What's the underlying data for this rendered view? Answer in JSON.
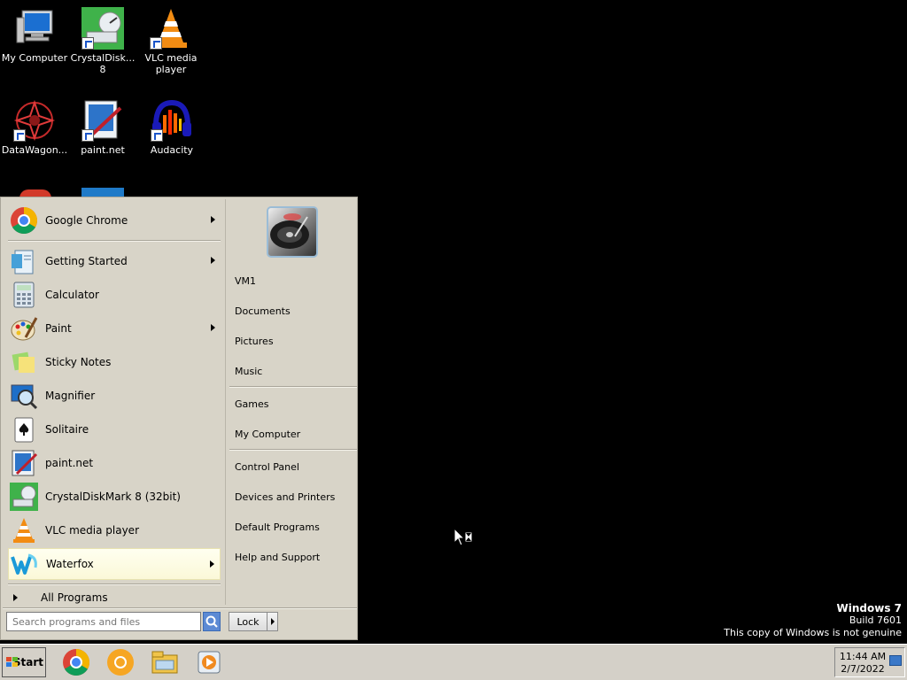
{
  "desktop": {
    "icons": [
      {
        "label": "My Computer",
        "icon": "computer-icon"
      },
      {
        "label": "CrystalDisk... 8",
        "icon": "crystaldiskmark-icon"
      },
      {
        "label": "VLC media player",
        "icon": "vlc-icon"
      },
      {
        "label": "DataWagon...",
        "icon": "datawagon-icon"
      },
      {
        "label": "paint.net",
        "icon": "paintnet-icon"
      },
      {
        "label": "Audacity",
        "icon": "audacity-icon"
      }
    ]
  },
  "start_menu": {
    "pinned": [
      {
        "label": "Google Chrome",
        "icon": "chrome-icon",
        "has_submenu": true
      }
    ],
    "programs": [
      {
        "label": "Getting Started",
        "icon": "getting-started-icon",
        "has_submenu": true
      },
      {
        "label": "Calculator",
        "icon": "calculator-icon",
        "has_submenu": false
      },
      {
        "label": "Paint",
        "icon": "paint-icon",
        "has_submenu": true
      },
      {
        "label": "Sticky Notes",
        "icon": "sticky-notes-icon",
        "has_submenu": false
      },
      {
        "label": "Magnifier",
        "icon": "magnifier-icon",
        "has_submenu": false
      },
      {
        "label": "Solitaire",
        "icon": "solitaire-icon",
        "has_submenu": false
      },
      {
        "label": "paint.net",
        "icon": "paintnet-icon",
        "has_submenu": false
      },
      {
        "label": "CrystalDiskMark 8 (32bit)",
        "icon": "crystaldiskmark-icon",
        "has_submenu": false
      },
      {
        "label": "VLC media player",
        "icon": "vlc-icon",
        "has_submenu": false
      },
      {
        "label": "Waterfox",
        "icon": "waterfox-icon",
        "has_submenu": true,
        "highlighted": true
      }
    ],
    "all_programs_label": "All Programs",
    "search_placeholder": "Search programs and files",
    "right_items": {
      "group1": [
        "VM1",
        "Documents",
        "Pictures",
        "Music"
      ],
      "group2": [
        "Games",
        "My Computer"
      ],
      "group3": [
        "Control Panel",
        "Devices and Printers",
        "Default Programs",
        "Help and Support"
      ]
    },
    "lock_label": "Lock"
  },
  "watermark": {
    "os": "Windows 7",
    "build": "Build 7601",
    "notice": "This copy of Windows is not genuine"
  },
  "taskbar": {
    "start_label": "Start",
    "pinned": [
      "chrome-icon",
      "chrome-canary-icon",
      "explorer-icon",
      "media-player-icon"
    ],
    "clock_time": "11:44 AM",
    "clock_date": "2/7/2022"
  },
  "colors": {
    "menu_bg": "#d8d4c8",
    "taskbar_bg": "#d4d0c8",
    "highlight": "#fbf8d8"
  }
}
